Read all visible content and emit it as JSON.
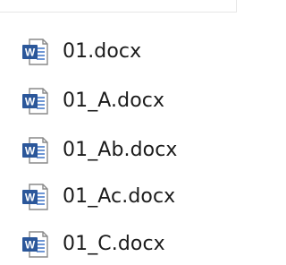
{
  "files": [
    {
      "name": "01.docx",
      "icon": "word-document-icon"
    },
    {
      "name": "01_A.docx",
      "icon": "word-document-icon"
    },
    {
      "name": "01_Ab.docx",
      "icon": "word-document-icon"
    },
    {
      "name": "01_Ac.docx",
      "icon": "word-document-icon"
    },
    {
      "name": "01_C.docx",
      "icon": "word-document-icon"
    }
  ],
  "colors": {
    "word_blue": "#2b579a",
    "word_blue_light": "#4a7cc9",
    "page_border": "#8a8a8a",
    "text": "#1b1b1b"
  }
}
